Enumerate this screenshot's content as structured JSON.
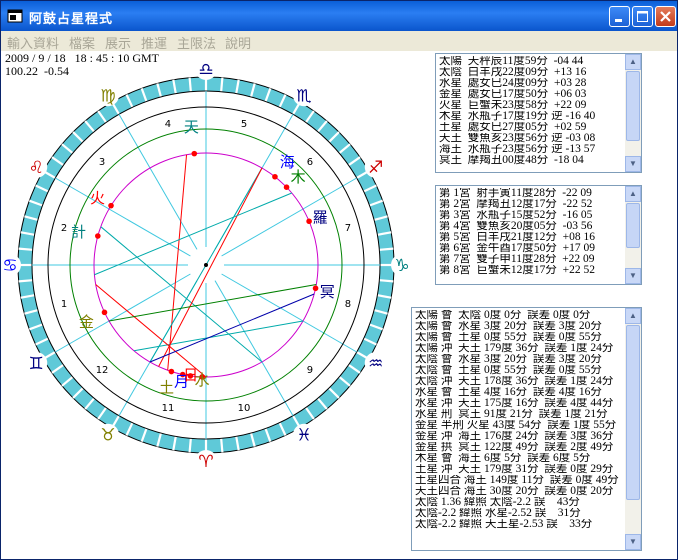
{
  "window": {
    "title": "阿鼓占星程式"
  },
  "menu": [
    "輸入資料",
    "檔案",
    "展示",
    "推運",
    "主限法",
    "說明"
  ],
  "info": {
    "datetime": "2009 / 9 / 18   18 : 45 : 10 GMT",
    "coords": "100.22  -0.54"
  },
  "chart": {
    "zodiac_signs": [
      "♑",
      "♐",
      "♏",
      "♎",
      "♍",
      "♌",
      "♋",
      "♊",
      "♉",
      "♈",
      "♓",
      "♒"
    ],
    "house_numbers": [
      "1",
      "2",
      "3",
      "4",
      "5",
      "6",
      "7",
      "8",
      "9",
      "10",
      "11",
      "12"
    ],
    "planets": [
      {
        "label": "天",
        "color": "#008080"
      },
      {
        "label": "海",
        "color": "#0000ff"
      },
      {
        "label": "木",
        "color": "#008000"
      },
      {
        "label": "羅",
        "color": "#000080"
      },
      {
        "label": "冥",
        "color": "#000080"
      },
      {
        "label": "火",
        "color": "#ff0000"
      },
      {
        "label": "計",
        "color": "#008080"
      },
      {
        "label": "金",
        "color": "#808000"
      },
      {
        "label": "土",
        "color": "#808000"
      },
      {
        "label": "月",
        "color": "#0000ff"
      },
      {
        "label": "日",
        "color": "#ff0000"
      },
      {
        "label": "水",
        "color": "#808000"
      }
    ]
  },
  "planet_list": [
    "太陽  天秤辰11度59分  -04 44",
    "太陰  白羊戌22度09分  +13 16",
    "水星  處女巳24度09分  +03 28",
    "金星  處女巳17度50分  +06 03",
    "火星  巨蟹未23度58分  +22 09",
    "木星  水瓶子17度19分 逆 -16 40",
    "土星  處女巳27度05分  +02 59",
    "天王  雙魚亥23度56分 逆 -03 08",
    "海王  水瓶子23度56分 逆 -13 57",
    "冥王  摩羯丑00度48分  -18 04"
  ],
  "house_list": [
    "第 1宮  射手寅11度28分  -22 09",
    "第 2宮  摩羯丑12度17分  -22 52",
    "第 3宮  水瓶子15度52分  -16 05",
    "第 4宮  雙魚亥20度05分  -03 56",
    "第 5宮  白羊戌21度12分  +08 16",
    "第 6宮  金牛酉17度50分  +17 09",
    "第 7宮  雙子申11度28分  +22 09",
    "第 8宮  巨蟹未12度17分  +22 52"
  ],
  "aspect_list": [
    "太陽 會  太陰 0度 0分  誤差 0度 0分",
    "太陽 會  水星 3度 20分  誤差 3度 20分",
    "太陽 會  土星 0度 55分  誤差 0度 55分",
    "太陽 沖  天王 179度 36分  誤差 1度 24分",
    "太陰 會  水星 3度 20分  誤差 3度 20分",
    "太陰 會  土星 0度 55分  誤差 0度 55分",
    "太陰 沖  天王 178度 36分  誤差 1度 24分",
    "水星 會  土星 4度 16分  誤差 4度 16分",
    "水星 沖  天王 175度 16分  誤差 4度 44分",
    "水星 刑  冥王 91度 21分  誤差 1度 21分",
    "金星 半刑 火星 43度 54分  誤差 1度 55分",
    "金星 沖  海王 176度 24分  誤差 3度 36分",
    "金星 拱  冥王 122度 49分  誤差 2度 49分",
    "木星 會  海王 6度 5分  誤差 6度 5分",
    "土星 沖  天王 179度 31分  誤差 0度 29分",
    "土星四合 海王 149度 11分  誤差 0度 49分",
    "天王四合 海王 30度 20分  誤差 0度 20分",
    "太陰 1.36 緯照 太陰-2.2 誤    43分",
    "太陰-2.2 緯照 水星-2.52 誤    31分",
    "太陰-2.2 緯照 天王星-2.53 誤    33分"
  ]
}
